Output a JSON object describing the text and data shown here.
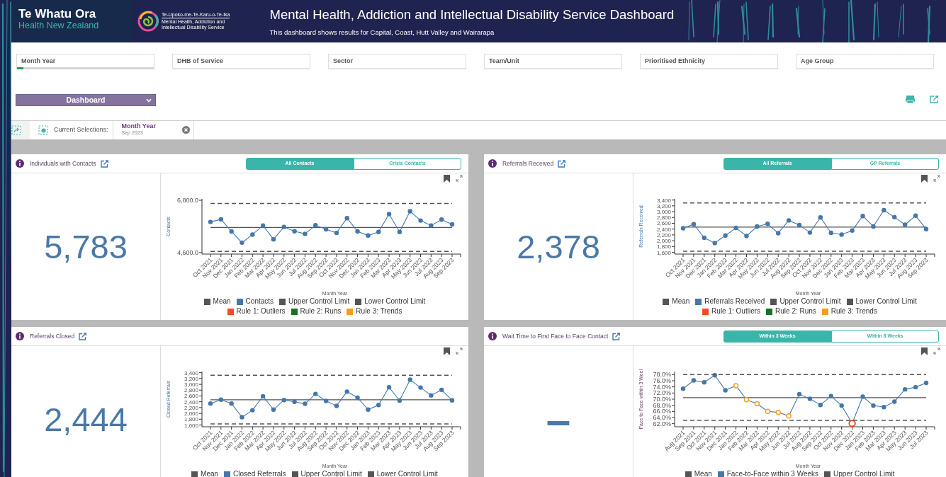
{
  "header": {
    "org_name": "Te Whatu Ora",
    "org_subtitle": "Health New Zealand",
    "service_lines": [
      "Te-Upoko-me-Te-Karu-o-Te-Ika",
      "Mental Health, Addiction and",
      "Intellectual Disability Service"
    ],
    "title": "Mental Health, Addiction and Intellectual Disability Service Dashboard",
    "subtitle": "This dashboard shows results for Capital, Coast, Hutt Valley and Wairarapa"
  },
  "filters": [
    {
      "label": "Month Year",
      "has_selection": true
    },
    {
      "label": "DHB of Service",
      "has_selection": false
    },
    {
      "label": "Sector",
      "has_selection": false
    },
    {
      "label": "Team/Unit",
      "has_selection": false
    },
    {
      "label": "Prioritised Ethnicity",
      "has_selection": false
    },
    {
      "label": "Age Group",
      "has_selection": false
    }
  ],
  "sheet_menu": {
    "value": "Dashboard"
  },
  "current_selections": {
    "label": "Current Selections:",
    "chips": [
      {
        "field": "Month Year",
        "value": "Sep 2023"
      }
    ]
  },
  "panels": [
    {
      "title": "Individuals with Contacts",
      "toggle": [
        {
          "label": "All Contacts",
          "selected": true
        },
        {
          "label": "Crisis Contacts",
          "selected": false
        }
      ],
      "kpi": "5,783",
      "chart_data": {
        "type": "line",
        "xlabel": "Month Year",
        "ylabel": "Contacts",
        "categories": [
          "Oct 2021",
          "Nov 2021",
          "Dec 2021",
          "Jan 2022",
          "Feb 2022",
          "Mar 2022",
          "Apr 2022",
          "May 2022",
          "Jun 2022",
          "Jul 2022",
          "Aug 2022",
          "Sep 2022",
          "Oct 2022",
          "Nov 2022",
          "Dec 2022",
          "Jan 2023",
          "Feb 2023",
          "Mar 2023",
          "Apr 2023",
          "May 2023",
          "Jun 2023",
          "Jul 2023",
          "Aug 2023",
          "Sep 2023"
        ],
        "ylim": [
          4540,
          6860
        ],
        "yticks": [
          {
            "value": 4600,
            "label": "4,600.0"
          },
          {
            "value": 6800,
            "label": "6,800.0"
          }
        ],
        "series": [
          {
            "name": "Mean",
            "color": "#555555",
            "values": [
              5660,
              5660,
              5660,
              5660,
              5660,
              5660,
              5660,
              5660,
              5660,
              5660,
              5660,
              5660,
              5660,
              5660,
              5660,
              5660,
              5660,
              5660,
              5660,
              5660,
              5660,
              5660,
              5660,
              5660
            ]
          },
          {
            "name": "Contacts",
            "color": "#4477aa",
            "marker": true,
            "values": [
              5890,
              6000,
              5490,
              5020,
              5360,
              5740,
              5160,
              5680,
              5500,
              5390,
              5750,
              5580,
              5430,
              6050,
              5490,
              5320,
              5470,
              6220,
              5470,
              6340,
              5950,
              5740,
              5990,
              5790
            ]
          },
          {
            "name": "Upper Control Limit",
            "color": "#555555",
            "line_style": "dashed",
            "values": [
              6670,
              6670,
              6670,
              6670,
              6670,
              6670,
              6670,
              6670,
              6670,
              6670,
              6670,
              6670,
              6670,
              6670,
              6670,
              6670,
              6670,
              6670,
              6670,
              6670,
              6670,
              6670,
              6670,
              6670
            ]
          },
          {
            "name": "Lower Control Limit",
            "color": "#555555",
            "line_style": "dashed",
            "values": [
              4650,
              4650,
              4650,
              4650,
              4650,
              4650,
              4650,
              4650,
              4650,
              4650,
              4650,
              4650,
              4650,
              4650,
              4650,
              4650,
              4650,
              4650,
              4650,
              4650,
              4650,
              4650,
              4650,
              4650
            ]
          }
        ]
      },
      "rule_legend": [
        {
          "label": "Rule 1: Outliers",
          "color": "#f44a25"
        },
        {
          "label": "Rule 2: Runs",
          "color": "#1e6e27"
        },
        {
          "label": "Rule 3: Trends",
          "color": "#f79c21"
        }
      ]
    },
    {
      "title": "Referrals Received",
      "toggle": [
        {
          "label": "All Referrals",
          "selected": true
        },
        {
          "label": "GP Referrals",
          "selected": false
        }
      ],
      "kpi": "2,378",
      "chart_data": {
        "type": "line",
        "xlabel": "Month Year",
        "ylabel": "Referrals Received",
        "categories": [
          "Oct 2021",
          "Nov 2021",
          "Dec 2021",
          "Jan 2022",
          "Feb 2022",
          "Mar 2022",
          "Apr 2022",
          "May 2022",
          "Jun 2022",
          "Jul 2022",
          "Aug 2022",
          "Sep 2022",
          "Oct 2022",
          "Nov 2022",
          "Dec 2022",
          "Jan 2023",
          "Feb 2023",
          "Mar 2023",
          "Apr 2023",
          "May 2023",
          "Jun 2023",
          "Jul 2023",
          "Aug 2023",
          "Sep 2023"
        ],
        "ylim": [
          1540,
          3440
        ],
        "yticks": [
          {
            "value": 1600,
            "label": "1,600"
          },
          {
            "value": 1800,
            "label": "1,800"
          },
          {
            "value": 2000,
            "label": "2,000"
          },
          {
            "value": 2200,
            "label": "2,200"
          },
          {
            "value": 2400,
            "label": "2,400"
          },
          {
            "value": 2600,
            "label": "2,600"
          },
          {
            "value": 2800,
            "label": "2,800"
          },
          {
            "value": 3000,
            "label": "3,000"
          },
          {
            "value": 3200,
            "label": "3,200"
          },
          {
            "value": 3400,
            "label": "3,400"
          }
        ],
        "series": [
          {
            "name": "Mean",
            "color": "#555555",
            "values": [
              2470,
              2470,
              2470,
              2470,
              2470,
              2470,
              2470,
              2470,
              2470,
              2470,
              2470,
              2470,
              2470,
              2470,
              2470,
              2470,
              2470,
              2470,
              2470,
              2470,
              2470,
              2470,
              2470,
              2470
            ]
          },
          {
            "name": "Referrals Received",
            "color": "#4477aa",
            "marker": true,
            "values": [
              2430,
              2570,
              2100,
              1920,
              2180,
              2440,
              2160,
              2490,
              2580,
              2260,
              2700,
              2540,
              2280,
              2800,
              2270,
              2210,
              2350,
              2850,
              2490,
              3050,
              2810,
              2550,
              2860,
              2400
            ]
          },
          {
            "name": "Upper Control Limit",
            "color": "#555555",
            "line_style": "dashed",
            "values": [
              3300,
              3300,
              3300,
              3300,
              3300,
              3300,
              3300,
              3300,
              3300,
              3300,
              3300,
              3300,
              3300,
              3300,
              3300,
              3300,
              3300,
              3300,
              3300,
              3300,
              3300,
              3300,
              3300,
              3300
            ]
          },
          {
            "name": "Lower Control Limit",
            "color": "#555555",
            "line_style": "dashed",
            "values": [
              1640,
              1640,
              1640,
              1640,
              1640,
              1640,
              1640,
              1640,
              1640,
              1640,
              1640,
              1640,
              1640,
              1640,
              1640,
              1640,
              1640,
              1640,
              1640,
              1640,
              1640,
              1640,
              1640,
              1640
            ]
          }
        ]
      },
      "rule_legend": [
        {
          "label": "Rule 1: Outliers",
          "color": "#f44a25"
        },
        {
          "label": "Rule 2: Runs",
          "color": "#1e6e27"
        },
        {
          "label": "Rule 3: Trends",
          "color": "#f79c21"
        }
      ]
    },
    {
      "title": "Referrals Closed",
      "kpi": "2,444",
      "chart_data": {
        "type": "line",
        "xlabel": "Month Year",
        "ylabel": "Closed Referrals",
        "categories": [
          "Oct 2021",
          "Nov 2021",
          "Dec 2021",
          "Jan 2022",
          "Feb 2022",
          "Mar 2022",
          "Apr 2022",
          "May 2022",
          "Jun 2022",
          "Jul 2022",
          "Aug 2022",
          "Sep 2022",
          "Oct 2022",
          "Nov 2022",
          "Dec 2022",
          "Jan 2023",
          "Feb 2023",
          "Mar 2023",
          "Apr 2023",
          "May 2023",
          "Jun 2023",
          "Jul 2023",
          "Aug 2023",
          "Sep 2023"
        ],
        "ylim": [
          1540,
          3440
        ],
        "yticks": [
          {
            "value": 1600,
            "label": "1,600"
          },
          {
            "value": 1800,
            "label": "1,800"
          },
          {
            "value": 2000,
            "label": "2,000"
          },
          {
            "value": 2200,
            "label": "2,200"
          },
          {
            "value": 2400,
            "label": "2,400"
          },
          {
            "value": 2600,
            "label": "2,600"
          },
          {
            "value": 2800,
            "label": "2,800"
          },
          {
            "value": 3000,
            "label": "3,000"
          },
          {
            "value": 3200,
            "label": "3,200"
          },
          {
            "value": 3400,
            "label": "3,400"
          }
        ],
        "series": [
          {
            "name": "Mean",
            "color": "#555555",
            "values": [
              2470,
              2470,
              2470,
              2470,
              2470,
              2470,
              2470,
              2470,
              2470,
              2470,
              2470,
              2470,
              2470,
              2470,
              2470,
              2470,
              2470,
              2470,
              2470,
              2470,
              2470,
              2470,
              2470,
              2470
            ]
          },
          {
            "name": "Closed Referrals",
            "color": "#4477aa",
            "marker": true,
            "values": [
              2340,
              2470,
              2340,
              1870,
              2110,
              2590,
              2130,
              2460,
              2400,
              2330,
              2670,
              2430,
              2260,
              2750,
              2540,
              2130,
              2290,
              2900,
              2440,
              3160,
              2890,
              2620,
              2810,
              2450
            ]
          },
          {
            "name": "Upper Control Limit",
            "color": "#555555",
            "line_style": "dashed",
            "values": [
              3310,
              3310,
              3310,
              3310,
              3310,
              3310,
              3310,
              3310,
              3310,
              3310,
              3310,
              3310,
              3310,
              3310,
              3310,
              3310,
              3310,
              3310,
              3310,
              3310,
              3310,
              3310,
              3310,
              3310
            ]
          },
          {
            "name": "Lower Control Limit",
            "color": "#555555",
            "line_style": "dashed",
            "values": [
              1640,
              1640,
              1640,
              1640,
              1640,
              1640,
              1640,
              1640,
              1640,
              1640,
              1640,
              1640,
              1640,
              1640,
              1640,
              1640,
              1640,
              1640,
              1640,
              1640,
              1640,
              1640,
              1640,
              1640
            ]
          }
        ]
      }
    },
    {
      "title": "Wait Time to First Face to Face Contact",
      "toggle": [
        {
          "label": "Within 3 Weeks",
          "selected": true
        },
        {
          "label": "Within 8 Weeks",
          "selected": false
        }
      ],
      "kpi": "–",
      "chart_data": {
        "type": "line",
        "xlabel": "Month Year",
        "ylabel": "Face to Face within 3 Weel",
        "categories": [
          "Aug 2021",
          "Sep 2021",
          "Oct 2021",
          "Nov 2021",
          "Dec 2021",
          "Jan 2022",
          "Feb 2022",
          "Mar 2022",
          "Apr 2022",
          "May 2022",
          "Jun 2022",
          "Jul 2022",
          "Aug 2022",
          "Sep 2022",
          "Oct 2022",
          "Nov 2022",
          "Dec 2022",
          "Jan 2023",
          "Feb 2023",
          "Mar 2023",
          "Apr 2023",
          "May 2023",
          "Jun 2023",
          "Jul 2023"
        ],
        "ylim": [
          61,
          79
        ],
        "yticks": [
          {
            "value": 62,
            "label": "62.0%"
          },
          {
            "value": 64,
            "label": "64.0%"
          },
          {
            "value": 66,
            "label": "66.0%"
          },
          {
            "value": 68,
            "label": "68.0%"
          },
          {
            "value": 70,
            "label": "70.0%"
          },
          {
            "value": 72,
            "label": "72.0%"
          },
          {
            "value": 74,
            "label": "74.0%"
          },
          {
            "value": 76,
            "label": "76.0%"
          },
          {
            "value": 78,
            "label": "78.0%"
          }
        ],
        "series": [
          {
            "name": "Mean",
            "color": "#555555",
            "values": [
              70.5,
              70.5,
              70.5,
              70.5,
              70.5,
              70.5,
              70.5,
              70.5,
              70.5,
              70.5,
              70.5,
              70.5,
              70.5,
              70.5,
              70.5,
              70.5,
              70.5,
              70.5,
              70.5,
              70.5,
              70.5,
              70.5,
              70.5,
              70.5
            ]
          },
          {
            "name": "Face-to-Face within 3 Weeks",
            "color": "#4477aa",
            "marker": true,
            "values": [
              73.4,
              76.1,
              75.5,
              77.8,
              72.9,
              74.4,
              69.8,
              68.5,
              66.0,
              65.7,
              64.5,
              71.6,
              70.1,
              68.1,
              71.0,
              67.9,
              62.1,
              70.8,
              67.9,
              67.4,
              69.2,
              73.2,
              73.9,
              75.3
            ]
          },
          {
            "name": "Upper Control Limit",
            "color": "#555555",
            "line_style": "dashed",
            "values": [
              78.0,
              78.0,
              78.0,
              78.0,
              78.0,
              78.0,
              78.0,
              78.0,
              78.0,
              78.0,
              78.0,
              78.0,
              78.0,
              78.0,
              78.0,
              78.0,
              78.0,
              78.0,
              78.0,
              78.0,
              78.0,
              78.0,
              78.0,
              78.0
            ]
          },
          {
            "color": "#555555",
            "line_style": "dashed",
            "values": [
              63.1,
              63.1,
              63.1,
              63.1,
              63.1,
              63.1,
              63.1,
              63.1,
              63.1,
              63.1,
              63.1,
              63.1,
              63.1,
              63.1,
              63.1,
              63.1,
              63.1,
              63.1,
              63.1,
              63.1,
              63.1,
              63.1,
              63.1,
              63.1
            ]
          }
        ]
      },
      "point_rules": [
        {
          "trend": false,
          "outlier": false
        },
        {
          "trend": false,
          "outlier": false
        },
        {
          "trend": false,
          "outlier": false
        },
        {
          "trend": false,
          "outlier": false
        },
        {
          "trend": false,
          "outlier": false
        },
        {
          "trend": true,
          "outlier": false
        },
        {
          "trend": true,
          "outlier": false
        },
        {
          "trend": true,
          "outlier": false
        },
        {
          "trend": true,
          "outlier": false
        },
        {
          "trend": true,
          "outlier": false
        },
        {
          "trend": true,
          "outlier": false
        },
        {
          "trend": false,
          "outlier": false
        },
        {
          "trend": false,
          "outlier": false
        },
        {
          "trend": false,
          "outlier": false
        },
        {
          "trend": false,
          "outlier": false
        },
        {
          "trend": false,
          "outlier": false
        },
        {
          "trend": false,
          "outlier": true
        },
        {
          "trend": false,
          "outlier": false
        },
        {
          "trend": false,
          "outlier": false
        },
        {
          "trend": false,
          "outlier": false
        },
        {
          "trend": false,
          "outlier": false
        },
        {
          "trend": false,
          "outlier": false
        },
        {
          "trend": false,
          "outlier": false
        },
        {
          "trend": false,
          "outlier": false
        }
      ]
    }
  ]
}
